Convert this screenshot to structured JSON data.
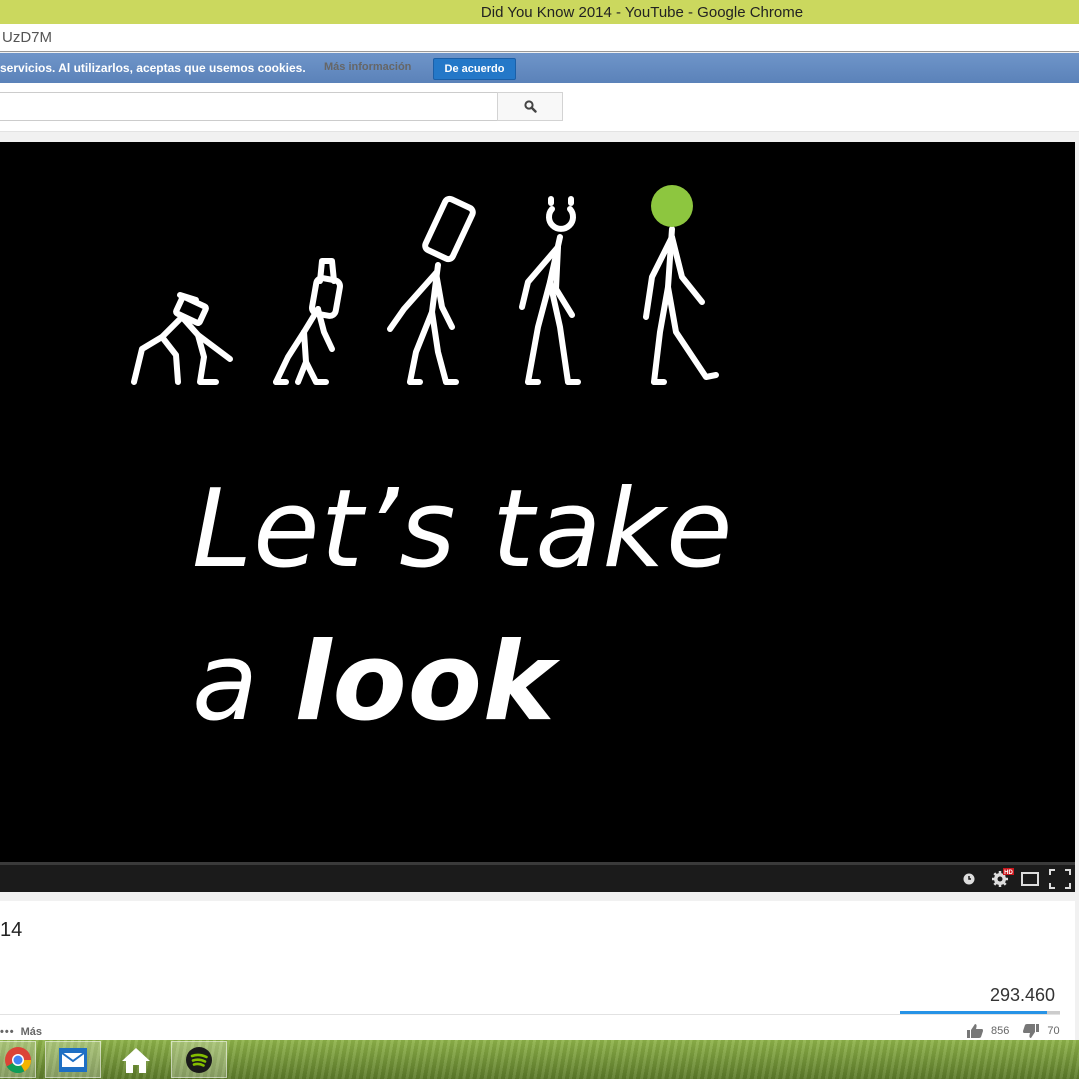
{
  "window": {
    "title": "Did You Know 2014 - YouTube - Google Chrome"
  },
  "browser": {
    "url_fragment": "UzD7M"
  },
  "cookie_notice": {
    "message": "servicios. Al utilizarlos, aceptas que usemos cookies.",
    "more_info": "Más información",
    "accept": "De acuerdo"
  },
  "search": {
    "value": "",
    "icon": "search-icon"
  },
  "video": {
    "line1": "Let’s take",
    "line2_light": "a ",
    "line2_bold": "look",
    "accent_color": "#8dc63f"
  },
  "player_controls": {
    "hd_badge": "HD"
  },
  "video_info": {
    "title_fragment": "14",
    "views": "293.460",
    "more": "Más",
    "likes": "856",
    "dislikes": "70"
  },
  "taskbar": {
    "apps": [
      "chrome-icon",
      "mail-icon",
      "home-icon",
      "spotify-icon"
    ]
  }
}
